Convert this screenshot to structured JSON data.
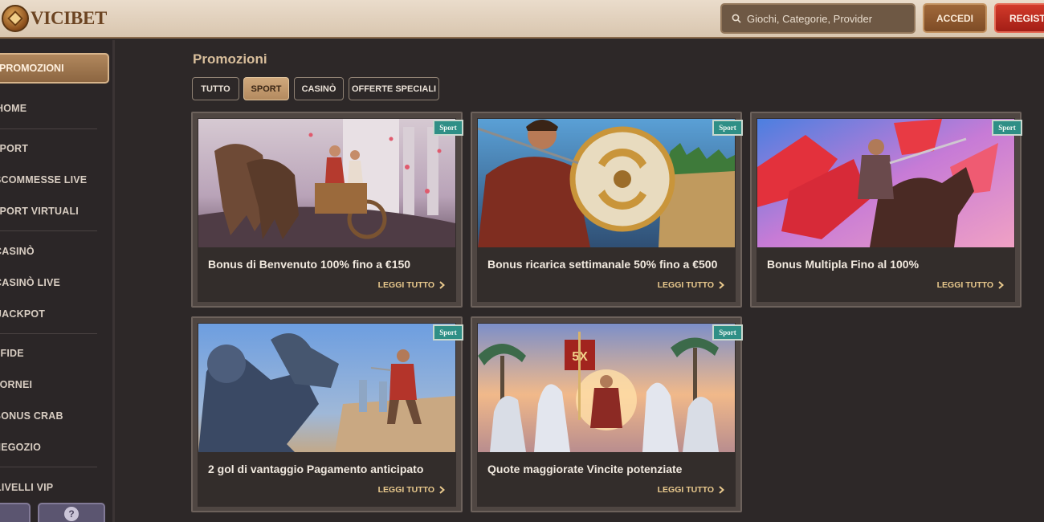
{
  "brand": {
    "name": "VICIBET"
  },
  "header": {
    "search_placeholder": "Giochi, Categorie, Provider",
    "login_label": "ACCEDI",
    "register_label": "REGISTRATI"
  },
  "sidebar": {
    "active": "PROMOZIONI",
    "items": [
      "HOME",
      "SPORT",
      "SCOMMESSE LIVE",
      "SPORT VIRTUALI",
      "CASINÒ",
      "CASINÒ LIVE",
      "JACKPOT",
      "SFIDE",
      "TORNEI",
      "BONUS CRAB",
      "NEGOZIO",
      "LIVELLI VIP"
    ],
    "help_icon": "?"
  },
  "main": {
    "title": "Promozioni",
    "filters": [
      "TUTTO",
      "SPORT",
      "CASINÒ",
      "OFFERTE SPECIALI"
    ],
    "active_filter": "SPORT",
    "cards": [
      {
        "title": "Bonus di Benvenuto 100% fino a €150",
        "link": "LEGGI TUTTO",
        "badge": "Sport",
        "image": "chariot-race"
      },
      {
        "title": "Bonus ricarica settimanale 50% fino a €500",
        "link": "LEGGI TUTTO",
        "badge": "Sport",
        "image": "gladiator-shield"
      },
      {
        "title": "Bonus Multipla Fino al 100%",
        "link": "LEGGI TUTTO",
        "badge": "Sport",
        "image": "knight-on-horse"
      },
      {
        "title": "2 gol di vantaggio Pagamento anticipato",
        "link": "LEGGI TUTTO",
        "badge": "Sport",
        "image": "armored-fighters"
      },
      {
        "title": "Quote maggiorate Vincite potenziate",
        "link": "LEGGI TUTTO",
        "badge": "Sport",
        "image": "emperor-white-horses",
        "banner_text": "5X"
      }
    ]
  },
  "colors": {
    "accent": "#b38a5f",
    "register": "#c22d20",
    "badge": "#2f8f86",
    "background": "#2d2828"
  }
}
